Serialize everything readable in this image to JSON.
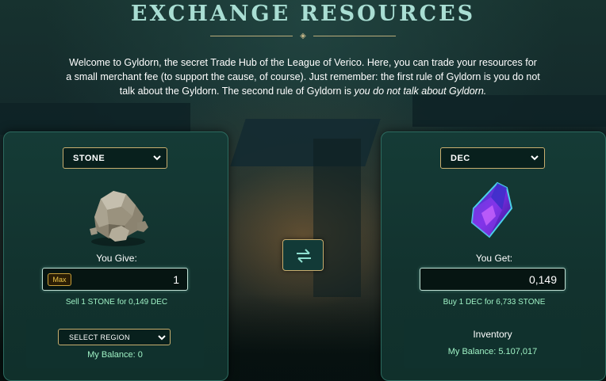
{
  "page": {
    "title": "EXCHANGE RESOURCES",
    "intro": {
      "text": "Welcome to Gyldorn, the secret Trade Hub of the League of Verico. Here, you can trade your resources for a small merchant fee (to support the cause, of course). Just remember: the first rule of Gyldorn is you do not talk about the Gyldorn. The second rule of Gyldorn is ",
      "emphasis": "you do not talk about Gyldorn."
    }
  },
  "give": {
    "resource_select": "STONE",
    "resource_icon": "stone-resource-icon",
    "label": "You Give:",
    "max_label": "Max",
    "amount": "1",
    "rate": "Sell 1 STONE for 0,149 DEC",
    "region_select": "SELECT REGION",
    "balance": "My Balance: 0"
  },
  "get": {
    "resource_select": "DEC",
    "resource_icon": "dec-crystal-icon",
    "label": "You Get:",
    "amount": "0,149",
    "rate": "Buy 1 DEC for 6,733 STONE",
    "inventory_title": "Inventory",
    "balance": "My Balance: 5.107,017"
  },
  "swap": {
    "icon": "swap-arrows-icon"
  },
  "colors": {
    "title": "#a9ded3",
    "accent_gold": "#c8ae6f",
    "rate_text": "#9ff2c5",
    "panel_bg": "#153b36"
  }
}
